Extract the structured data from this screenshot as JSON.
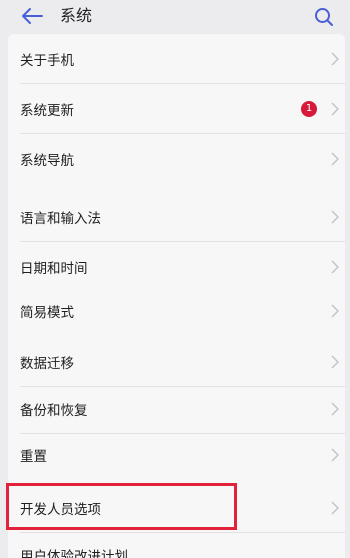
{
  "header": {
    "title": "系统"
  },
  "colors": {
    "accent": "#4a5fd6",
    "badge": "#d7193a",
    "highlight": "#e2223b"
  },
  "icons": {
    "back": "arrow-left-icon",
    "search": "search-icon",
    "chevron": "chevron-right-icon"
  },
  "items": [
    {
      "label": "关于手机"
    },
    {
      "label": "系统更新",
      "badge": "1"
    },
    {
      "label": "系统导航"
    },
    {
      "label": "语言和输入法"
    },
    {
      "label": "日期和时间"
    },
    {
      "label": "简易模式"
    },
    {
      "label": "数据迁移"
    },
    {
      "label": "备份和恢复"
    },
    {
      "label": "重置"
    },
    {
      "label": "开发人员选项"
    },
    {
      "label": "用户体验改进计划"
    }
  ]
}
